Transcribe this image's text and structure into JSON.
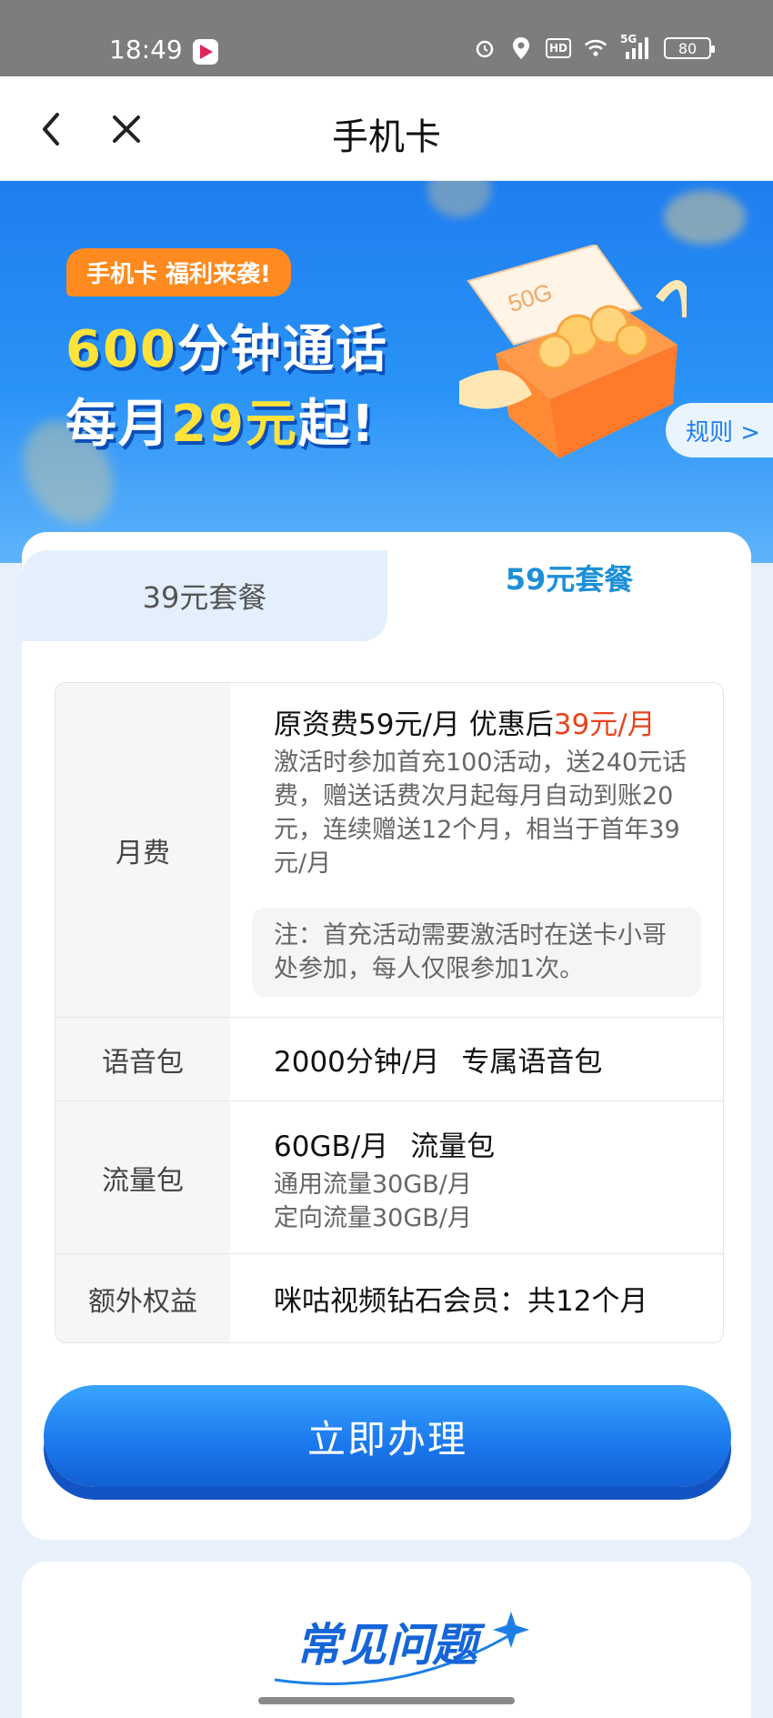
{
  "status_bar": {
    "time": "18:49",
    "network_label": "HD",
    "signal_label": "5G",
    "battery": "80"
  },
  "nav": {
    "title": "手机卡"
  },
  "banner": {
    "tag": "手机卡 福利来袭!",
    "line1_highlight": "600",
    "line1_text": "分钟通话",
    "line2_prefix": "每月",
    "line2_highlight": "29元",
    "line2_suffix": "起!",
    "gift_label": "50G",
    "rules_label": "规则 >"
  },
  "tabs": [
    {
      "label": "39元套餐",
      "active": false
    },
    {
      "label": "59元套餐",
      "active": true
    }
  ],
  "plan": {
    "monthly_fee": {
      "label": "月费",
      "main_prefix": "原资费59元/月 优惠后",
      "main_price": "39元/月",
      "detail": "激活时参加首充100活动，送240元话费，赠送话费次月起每月自动到账20元，连续赠送12个月，相当于首年39元/月",
      "note": "注：首充活动需要激活时在送卡小哥处参加，每人仅限参加1次。"
    },
    "voice": {
      "label": "语音包",
      "value": "2000分钟/月",
      "tag": "专属语音包"
    },
    "data": {
      "label": "流量包",
      "value": "60GB/月",
      "tag": "流量包",
      "general": "通用流量30GB/月",
      "directed": "定向流量30GB/月"
    },
    "extra": {
      "label": "额外权益",
      "value": "咪咕视频钻石会员：共12个月"
    }
  },
  "cta_label": "立即办理",
  "faq_title": "常见问题",
  "colors": {
    "primary": "#1e7ef0",
    "accent_red": "#e8431e",
    "tab_active": "#1c8fd8",
    "promo_yellow": "#ffe23a",
    "tag_orange": "#ff8a1f"
  }
}
